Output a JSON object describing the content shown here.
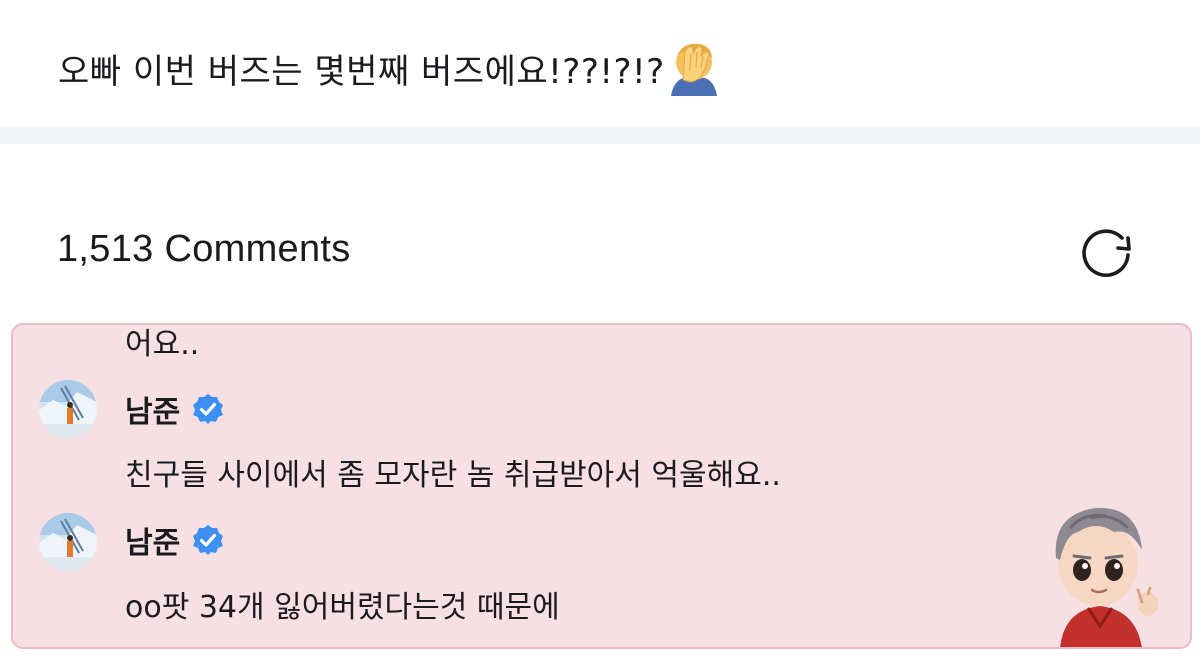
{
  "post": {
    "text": "오빠 이번 버즈는 몇번째 버즈에요!??!?!?",
    "emoji": "face-palm-emoji"
  },
  "comments_header": {
    "title": "1,513 Comments",
    "refresh_icon": "refresh-icon"
  },
  "thread": {
    "cut_text": "어요..",
    "comments": [
      {
        "author": "남준",
        "verified": true,
        "text": "친구들 사이에서 좀 모자란 놈 취급받아서 억울해요.."
      },
      {
        "author": "남준",
        "verified": true,
        "text": "oo팟 34개 잃어버렸다는것 때문에"
      }
    ]
  },
  "colors": {
    "panel_bg": "#f7e0e4",
    "panel_border": "#ecbcc5",
    "verified_blue": "#3d8ff0",
    "separator": "#f4f5f8"
  }
}
